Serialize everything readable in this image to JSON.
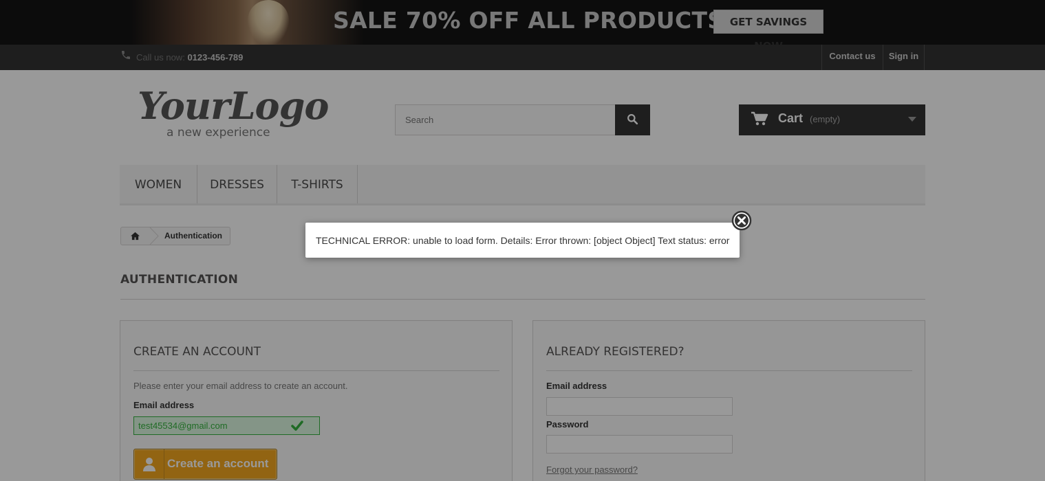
{
  "banner": {
    "title": "SALE 70% OFF ALL PRODUCTS",
    "cta": "GET SAVINGS NOW"
  },
  "topbar": {
    "call_label": "Call us now:",
    "phone": "0123-456-789",
    "contact": "Contact us",
    "signin": "Sign in"
  },
  "logo": {
    "main": "YourLogo",
    "sub": "a new experience"
  },
  "search": {
    "placeholder": "Search"
  },
  "cart": {
    "label": "Cart",
    "status": "(empty)"
  },
  "menu": {
    "items": [
      "WOMEN",
      "DRESSES",
      "T-SHIRTS"
    ]
  },
  "breadcrumb": {
    "current": "Authentication"
  },
  "page": {
    "heading": "AUTHENTICATION"
  },
  "create_account": {
    "title": "CREATE AN ACCOUNT",
    "hint": "Please enter your email address to create an account.",
    "email_label": "Email address",
    "email_value": "test45534@gmail.com",
    "button": "Create an account"
  },
  "login": {
    "title": "ALREADY REGISTERED?",
    "email_label": "Email address",
    "password_label": "Password",
    "forgot": "Forgot your password?"
  },
  "modal": {
    "message": "TECHNICAL ERROR: unable to load form. Details: Error thrown: [object Object] Text status: error"
  },
  "colors": {
    "banner_bg": "#141414",
    "navbar_bg": "#333333",
    "accent_orange": "#f4a71e",
    "success_green": "#35b33f",
    "overlay": "rgba(0,0,0,0.4)"
  }
}
